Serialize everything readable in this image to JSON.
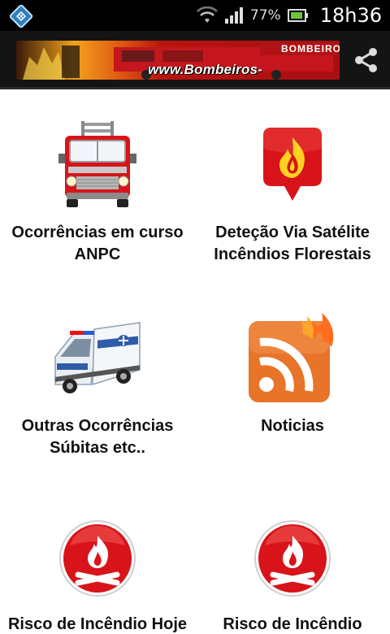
{
  "status_bar": {
    "battery_percent": "77%",
    "time": "18h36",
    "icons": [
      "app-icon",
      "wifi-icon",
      "signal-icon",
      "battery-icon"
    ]
  },
  "action_bar": {
    "banner_text": "www.Bombeiros-Portugal.net",
    "banner_brand": "BOMBEIROS",
    "share_icon": "share-icon"
  },
  "tiles": [
    {
      "label": "Ocorrências em curso ANPC",
      "icon": "fire-truck-icon"
    },
    {
      "label": "Deteção Via Satélite Incêndios Florestais",
      "icon": "fire-map-pin-icon"
    },
    {
      "label": "Outras Ocorrências Súbitas etc..",
      "icon": "ambulance-icon"
    },
    {
      "label": "Noticias",
      "icon": "rss-fire-icon"
    },
    {
      "label": "Risco de Incêndio Hoje",
      "icon": "campfire-icon"
    },
    {
      "label": "Risco de Incêndio Amanhã",
      "icon": "campfire-icon"
    }
  ],
  "colors": {
    "status_bar": "#000000",
    "action_bar": "#141414",
    "background": "#ffffff",
    "accent_red": "#d8141a",
    "rss_orange": "#e8742a"
  }
}
